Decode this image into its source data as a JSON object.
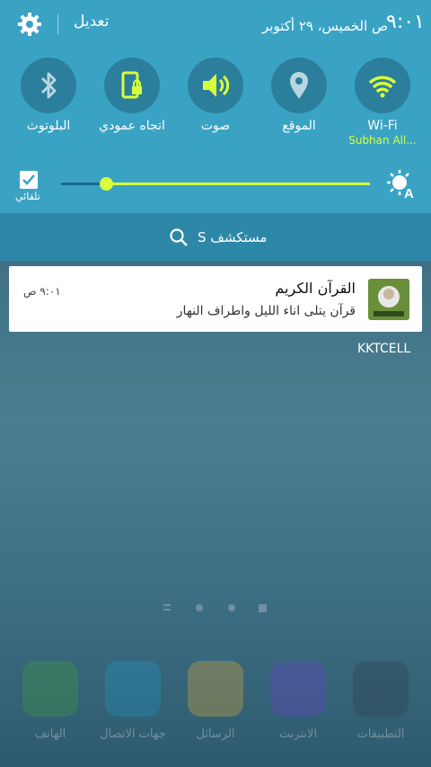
{
  "status": {
    "time": "٩:٠١",
    "date": "ص الخميس، ٢٩ أكتوبر",
    "edit_label": "تعديل"
  },
  "quick_settings": [
    {
      "label": "Wi-Fi",
      "sub": "Subhan All...",
      "icon": "wifi-icon",
      "active": true
    },
    {
      "label": "الموقع",
      "sub": "",
      "icon": "location-icon",
      "active": false
    },
    {
      "label": "صوت",
      "sub": "",
      "icon": "volume-icon",
      "active": true
    },
    {
      "label": "اتجاه عمودي",
      "sub": "",
      "icon": "portrait-lock-icon",
      "active": true
    },
    {
      "label": "البلوتوث",
      "sub": "",
      "icon": "bluetooth-icon",
      "active": false
    }
  ],
  "brightness": {
    "auto_label": "تلقائي",
    "auto_checked": true,
    "level": 0.15
  },
  "finder": {
    "label": "مستكشف S"
  },
  "notification": {
    "title": "القرآن الكريم",
    "text": "قرآن يتلى اناء الليل واطراف النهار",
    "time": "٩:٠١ ص"
  },
  "carrier": "KKTCELL",
  "dock": [
    {
      "label": "الهاتف",
      "icon": "phone-icon",
      "color": "#3fa535"
    },
    {
      "label": "جهات الاتصال",
      "icon": "contacts-icon",
      "color": "#1e9cc9"
    },
    {
      "label": "الرسائل",
      "icon": "messages-icon",
      "color": "#f1b233"
    },
    {
      "label": "الانترنت",
      "icon": "internet-icon",
      "color": "#6b3fd1"
    },
    {
      "label": "التطبيقات",
      "icon": "apps-icon",
      "color": "#2e3d4a"
    }
  ],
  "colors": {
    "accent": "#d8ff3a",
    "panel": "#3aa3c4",
    "tile": "#2b7e9c"
  }
}
